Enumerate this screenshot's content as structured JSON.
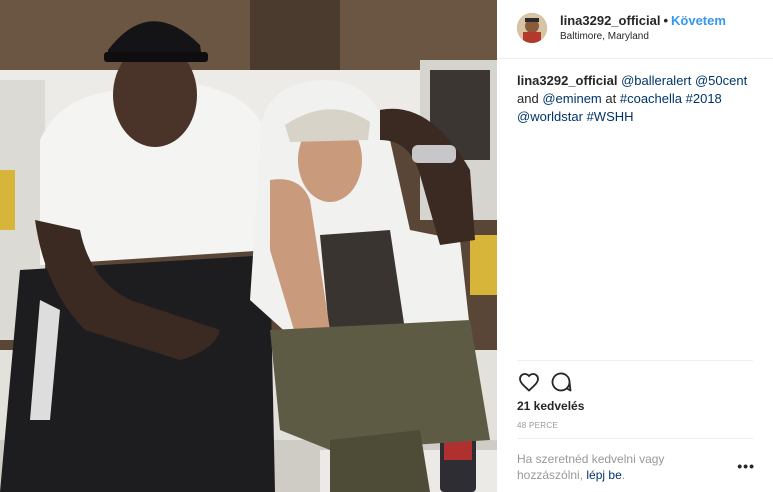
{
  "post": {
    "username": "lina3292_official",
    "dot": "•",
    "follow_label": "Követem",
    "location": "Baltimore, Maryland"
  },
  "caption": {
    "username": "lina3292_official",
    "parts": {
      "m1": "@balleralert",
      "m2": "@50cent",
      "and": "and",
      "m3": "@eminem",
      "at": "at",
      "h1": "#coachella",
      "h2": "#2018",
      "m4": "@worldstar",
      "h3": "#WSHH"
    }
  },
  "actions": {
    "like_icon": "heart-icon",
    "comment_icon": "comment-icon"
  },
  "likes": "21 kedvelés",
  "time_ago": "48 PERCE",
  "comment_prompt": {
    "text": "Ha szeretnéd kedvelni vagy hozzászólni,",
    "login": "lépj be",
    "period": "."
  },
  "more_label": "•••",
  "colors": {
    "link_blue": "#3897f0",
    "tag_blue": "#003569",
    "muted": "#999999",
    "text": "#262626"
  }
}
